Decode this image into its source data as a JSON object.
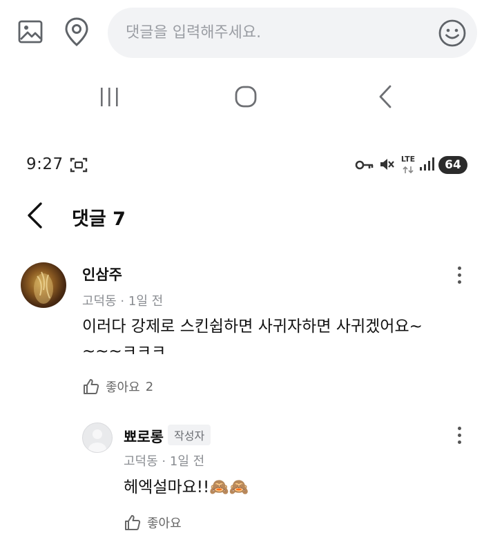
{
  "comment_bar": {
    "placeholder": "댓글을 입력해주세요.",
    "image_icon": "image-icon",
    "location_icon": "location-pin-icon",
    "emoji_icon": "smiley-icon"
  },
  "nav_bar": {
    "recents_icon": "recents-icon",
    "home_icon": "home-icon",
    "back_icon": "back-icon"
  },
  "status_bar": {
    "time": "9:27",
    "network": "LTE",
    "battery": "64"
  },
  "header": {
    "title": "댓글 7"
  },
  "comments": [
    {
      "author": "인삼주",
      "location": "고덕동",
      "time": "1일 전",
      "text_line1": "이러다 강제로 스킨쉽하면 사귀자하면 사귀겠어요~",
      "text_line2": "~~~ㅋㅋㅋ",
      "like_label": "좋아요",
      "like_count": "2"
    }
  ],
  "replies": [
    {
      "author": "뾰로롱",
      "badge": "작성자",
      "location": "고덕동",
      "time": "1일 전",
      "text": "헤엑설마요!!🙈🙈",
      "like_label": "좋아요"
    }
  ],
  "colors": {
    "input_bg": "#f2f3f5",
    "icon_gray": "#5f6368",
    "meta_gray": "#8a8d92"
  }
}
